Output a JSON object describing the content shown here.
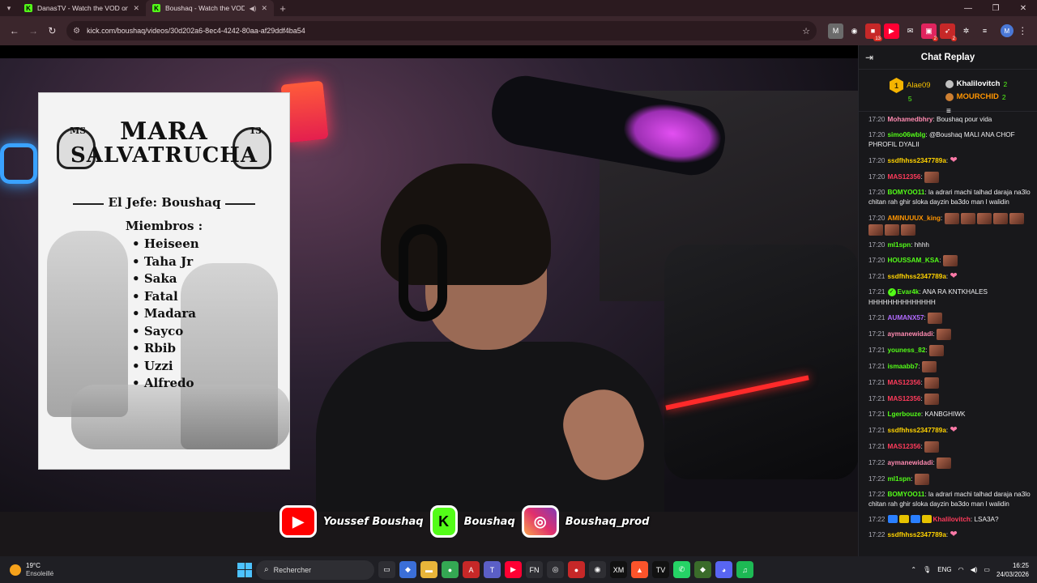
{
  "browser": {
    "tabs": [
      {
        "title": "DanasTV - Watch the VOD on Kick",
        "active": false
      },
      {
        "title": "Boushaq - Watch the VOD on Kick",
        "active": true
      }
    ],
    "new_tab": "+",
    "url": "kick.com/boushaq/videos/30d202a6-8ec4-4242-80aa-af29ddf4ba54",
    "profile_initial": "M",
    "extensions": [
      {
        "name": "m-ext-icon",
        "label": "M",
        "color": "#6b6b6b",
        "badge": ""
      },
      {
        "name": "sound-icon",
        "label": "◉",
        "color": "#3b262c",
        "badge": ""
      },
      {
        "name": "red-ext-icon",
        "label": "■",
        "color": "#c62828",
        "badge": "13"
      },
      {
        "name": "yt-ext-icon",
        "label": "▶",
        "color": "#ff0033",
        "badge": ""
      },
      {
        "name": "mail-ext-icon",
        "label": "✉",
        "color": "#3b262c",
        "badge": ""
      },
      {
        "name": "cards-ext-icon",
        "label": "▣",
        "color": "#e0245e",
        "badge": "2"
      },
      {
        "name": "rocket-ext-icon",
        "label": "➶",
        "color": "#c62828",
        "badge": "2"
      },
      {
        "name": "puzzle-icon",
        "label": "✲",
        "color": "#3b262c",
        "badge": ""
      },
      {
        "name": "playlist-icon",
        "label": "≡",
        "color": "#3b262c",
        "badge": ""
      }
    ]
  },
  "poster": {
    "tag_left": "MS",
    "tag_right": "13",
    "title_line1": "MARA",
    "title_line2": "SALVATRUCHA",
    "jefe": "El Jefe: Boushaq",
    "members_heading": "Miembros :",
    "members": [
      "Heiseen",
      "Taha Jr",
      "Saka",
      "Fatal",
      "Madara",
      "Sayco",
      "Rbib",
      "Uzzi",
      "Alfredo"
    ]
  },
  "socials": {
    "youtube": "Youssef Boushaq",
    "kick": "Boushaq",
    "instagram": "Boushaq_prod"
  },
  "chat": {
    "title": "Chat Replay",
    "leaderboard": {
      "first": {
        "rank": "1",
        "name": "Alae09",
        "count": "5"
      },
      "second": {
        "name": "Khalilovitch",
        "count": "2"
      },
      "third": {
        "name": "MOURCHID",
        "count": "2"
      }
    },
    "messages": [
      {
        "time": "17:20",
        "user": "Mohamedbhry",
        "color": "#ff8ab0",
        "text": "Boushaq pour vida",
        "emotes": 0
      },
      {
        "time": "17:20",
        "user": "simo06wblg",
        "color": "#53fc18",
        "text": "@Boushaq MALI ANA CHOF PHROFIL DYALII",
        "emotes": 0
      },
      {
        "time": "17:20",
        "user": "ssdfhhss2347789a",
        "color": "#ffd200",
        "text": "",
        "emotes": 1,
        "heart": true
      },
      {
        "time": "17:20",
        "user": "MAS12356",
        "color": "#ff3b5b",
        "text": "",
        "emotes": 1
      },
      {
        "time": "17:20",
        "user": "BOMYOO11",
        "color": "#53fc18",
        "text": "la adrari machi talhad daraja na3lo chitan rah ghir sloka dayzin ba3do man l walidin",
        "emotes": 0
      },
      {
        "time": "17:20",
        "user": "AMINUUUX_king",
        "color": "#ff9500",
        "text": "",
        "emotes": 8
      },
      {
        "time": "17:20",
        "user": "ml1spn",
        "color": "#53fc18",
        "text": "hhhh",
        "emotes": 0
      },
      {
        "time": "17:20",
        "user": "HOUSSAM_KSA",
        "color": "#53fc18",
        "text": "",
        "emotes": 1
      },
      {
        "time": "17:21",
        "user": "ssdfhhss2347789a",
        "color": "#ffd200",
        "text": "",
        "emotes": 1,
        "heart": true
      },
      {
        "time": "17:21",
        "user": "Evar4k",
        "color": "#53fc18",
        "text": "ANA RA KNTKHALES HHHHHHHHHHHHHH",
        "emotes": 0,
        "verified": true
      },
      {
        "time": "17:21",
        "user": "AUMANX57",
        "color": "#b26bff",
        "text": "",
        "emotes": 1
      },
      {
        "time": "17:21",
        "user": "aymanewidadi",
        "color": "#ff8ab0",
        "text": "",
        "emotes": 1
      },
      {
        "time": "17:21",
        "user": "youness_82",
        "color": "#53fc18",
        "text": "",
        "emotes": 1
      },
      {
        "time": "17:21",
        "user": "ismaabb7",
        "color": "#53fc18",
        "text": "",
        "emotes": 1
      },
      {
        "time": "17:21",
        "user": "MAS12356",
        "color": "#ff3b5b",
        "text": "",
        "emotes": 1
      },
      {
        "time": "17:21",
        "user": "MAS12356",
        "color": "#ff3b5b",
        "text": "",
        "emotes": 1
      },
      {
        "time": "17:21",
        "user": "Lgerbouze",
        "color": "#53fc18",
        "text": "KANBGHIWK",
        "emotes": 0
      },
      {
        "time": "17:21",
        "user": "ssdfhhss2347789a",
        "color": "#ffd200",
        "text": "",
        "emotes": 1,
        "heart": true
      },
      {
        "time": "17:21",
        "user": "MAS12356",
        "color": "#ff3b5b",
        "text": "",
        "emotes": 1
      },
      {
        "time": "17:22",
        "user": "aymanewidadi",
        "color": "#ff8ab0",
        "text": "",
        "emotes": 1
      },
      {
        "time": "17:22",
        "user": "ml1spn",
        "color": "#53fc18",
        "text": "",
        "emotes": 1
      },
      {
        "time": "17:22",
        "user": "BOMYOO11",
        "color": "#53fc18",
        "text": "la adrari machi talhad daraja na3lo chitan rah ghir sloka dayzin ba3do man l walidin",
        "emotes": 0
      },
      {
        "time": "17:22",
        "user": "Khalilovitch",
        "color": "#ff3b5b",
        "text": "LSA3A?",
        "emotes": 0,
        "badges": true
      },
      {
        "time": "17:22",
        "user": "ssdfhhss2347789a",
        "color": "#ffd200",
        "text": "",
        "emotes": 1,
        "heart": true
      }
    ]
  },
  "taskbar": {
    "temperature": "19°C",
    "condition": "Ensoleillé",
    "search_placeholder": "Rechercher",
    "apps": [
      {
        "name": "taskview-icon",
        "label": "▭",
        "color": "#2e2e33"
      },
      {
        "name": "copilot-icon",
        "label": "◆",
        "color": "#3b6fd8"
      },
      {
        "name": "explorer-icon",
        "label": "▬",
        "color": "#e8b53a"
      },
      {
        "name": "chrome-icon",
        "label": "●",
        "color": "#34a853"
      },
      {
        "name": "acrobat-icon",
        "label": "A",
        "color": "#c62828"
      },
      {
        "name": "teams-icon",
        "label": "T",
        "color": "#5b5fc7"
      },
      {
        "name": "youtube-icon",
        "label": "▶",
        "color": "#ff0033"
      },
      {
        "name": "fn-icon",
        "label": "FN",
        "color": "#2e2e33"
      },
      {
        "name": "vpn-icon",
        "label": "◎",
        "color": "#2e2e33"
      },
      {
        "name": "record-icon",
        "label": "●",
        "color": "#c62828"
      },
      {
        "name": "obs-icon",
        "label": "◉",
        "color": "#2e2e33"
      },
      {
        "name": "xm-icon",
        "label": "XM",
        "color": "#111111"
      },
      {
        "name": "brave-icon",
        "label": "▲",
        "color": "#fb542b"
      },
      {
        "name": "tradingview-icon",
        "label": "TV",
        "color": "#111111"
      },
      {
        "name": "whatsapp-icon",
        "label": "✆",
        "color": "#25d366"
      },
      {
        "name": "shield-icon",
        "label": "◆",
        "color": "#3a6b2a"
      },
      {
        "name": "discord-icon",
        "label": "◕",
        "color": "#5865f2"
      },
      {
        "name": "spotify-icon",
        "label": "♫",
        "color": "#1db954"
      }
    ],
    "language": "ENG",
    "time": "16:25",
    "date": "24/03/2026"
  }
}
